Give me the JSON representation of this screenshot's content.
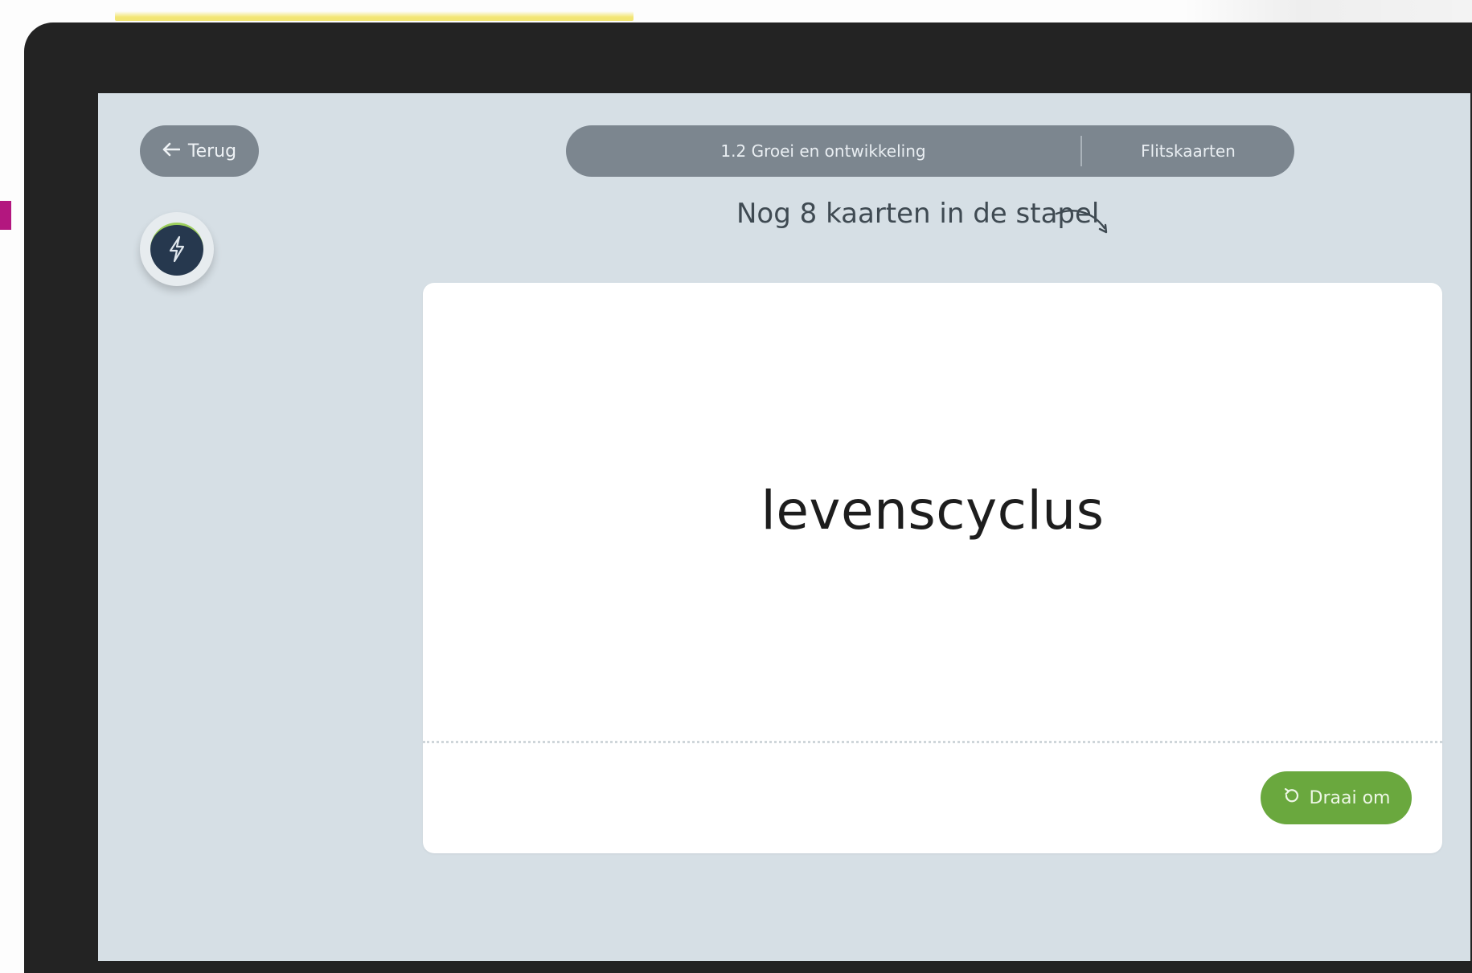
{
  "nav": {
    "back_label": "Terug"
  },
  "breadcrumb": {
    "section": "1.2 Groei en ontwikkeling",
    "mode": "Flitskaarten"
  },
  "deck": {
    "remaining_text": "Nog 8 kaarten in de stapel"
  },
  "card": {
    "term": "levenscyclus",
    "flip_label": "Draai om"
  },
  "colors": {
    "screen_bg": "#d6dfe5",
    "pill_bg": "#7c868f",
    "flip_button": "#6aa83e",
    "bolt_core": "#26384e",
    "frame": "#232323"
  },
  "icons": {
    "back": "arrow-left-icon",
    "bolt": "lightning-icon",
    "flip": "rotate-icon",
    "hint": "curved-arrow-icon"
  }
}
